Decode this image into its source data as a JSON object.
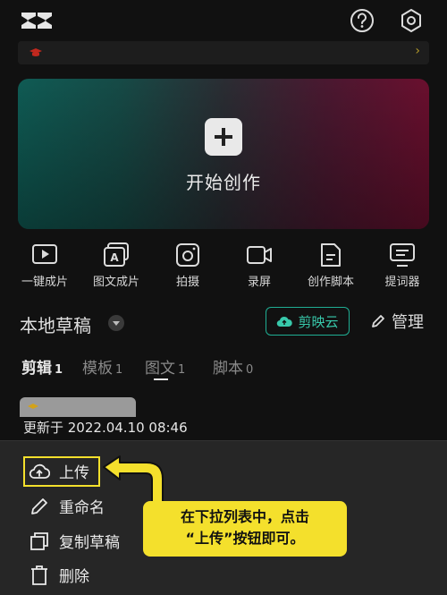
{
  "create": {
    "label": "开始创作"
  },
  "tools": [
    {
      "label": "一键成片",
      "icon": "play-icon"
    },
    {
      "label": "图文成片",
      "icon": "image-text-icon"
    },
    {
      "label": "拍摄",
      "icon": "camera-icon"
    },
    {
      "label": "录屏",
      "icon": "screen-record-icon"
    },
    {
      "label": "创作脚本",
      "icon": "script-icon"
    },
    {
      "label": "提词器",
      "icon": "teleprompter-icon"
    }
  ],
  "drafts": {
    "title": "本地草稿",
    "cloud_label": "剪映云",
    "manage_label": "管理",
    "tabs": [
      {
        "label": "剪辑",
        "count": "1",
        "active": true
      },
      {
        "label": "模板",
        "count": "1",
        "active": false
      },
      {
        "label": "图文",
        "count": "1",
        "active": false
      },
      {
        "label": "脚本",
        "count": "0",
        "active": false
      }
    ],
    "updated": "更新于 2022.04.10 08:46"
  },
  "menu": {
    "upload": "上传",
    "rename": "重命名",
    "copy": "复制草稿",
    "delete": "删除"
  },
  "annotation": {
    "line1": "在下拉列表中，点击",
    "line2": "“上传”按钮即可。"
  },
  "colors": {
    "accent_teal": "#1fae93",
    "highlight_yellow": "#f4e02c",
    "background": "#111111",
    "sheet": "#262626"
  }
}
